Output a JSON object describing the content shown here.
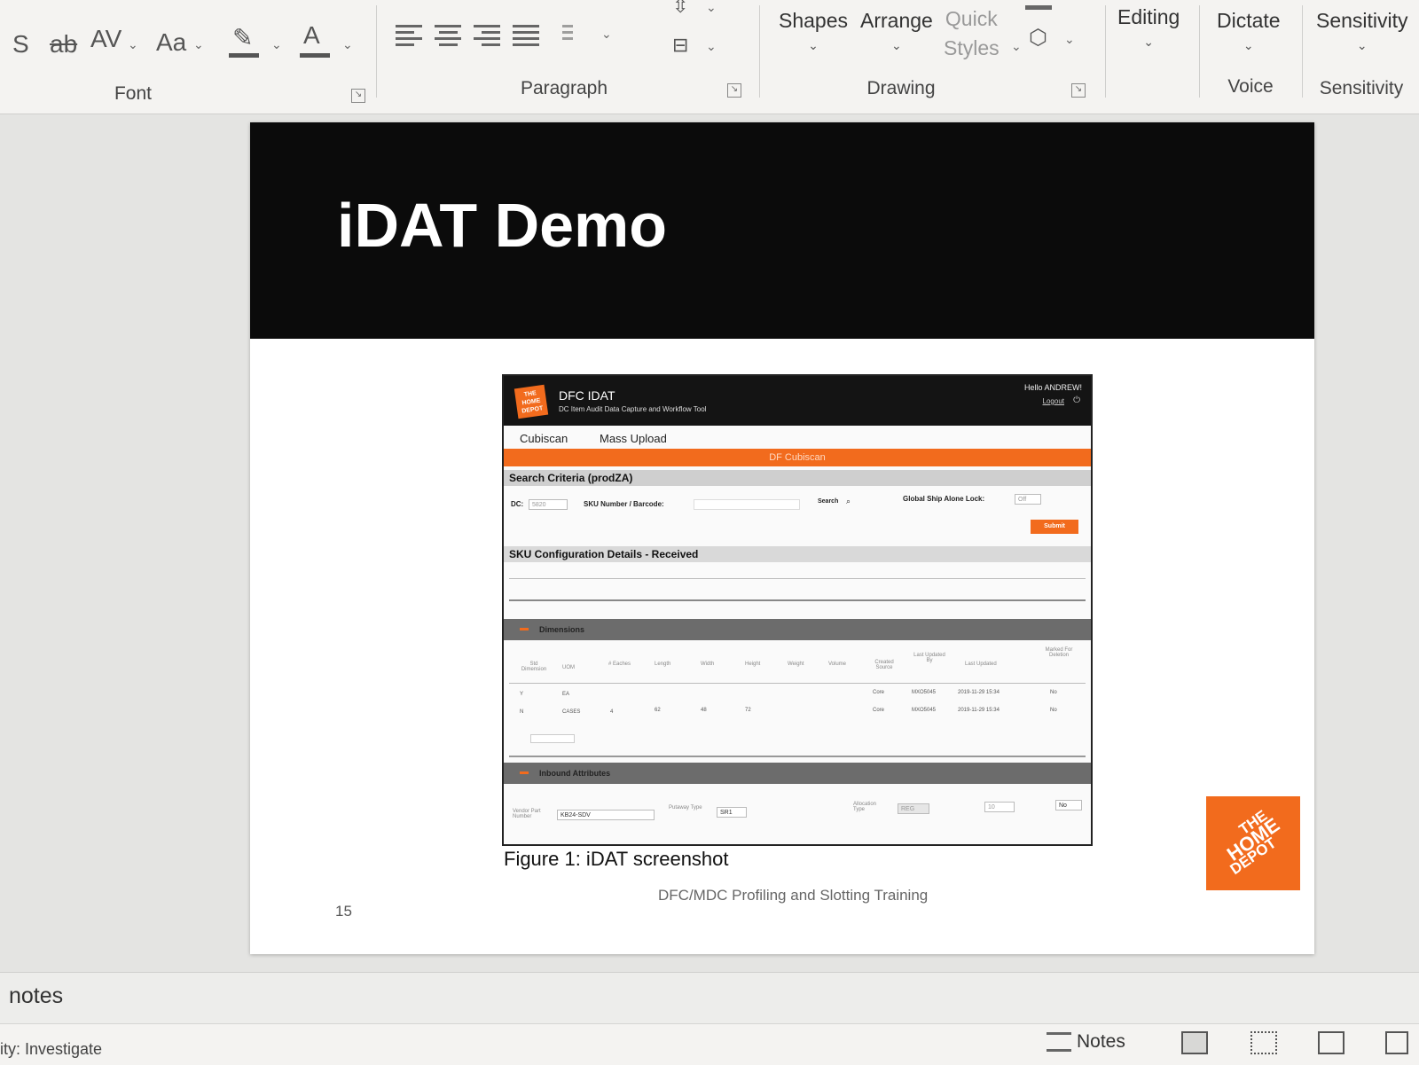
{
  "ribbon": {
    "font": {
      "label": "Font",
      "strikethrough": "ab",
      "char_spacing": "AV",
      "change_case": "Aa",
      "font_color": "A",
      "partial_glyph": "S"
    },
    "paragraph": {
      "label": "Paragraph"
    },
    "drawing": {
      "label": "Drawing",
      "shapes": "Shapes",
      "arrange": "Arrange",
      "quick_styles_line1": "Quick",
      "quick_styles_line2": "Styles"
    },
    "editing": {
      "label": "Editing"
    },
    "voice": {
      "label": "Voice",
      "dictate": "Dictate"
    },
    "sensitivity": {
      "label": "Sensitivity",
      "button": "Sensitivity"
    }
  },
  "slide": {
    "title": "iDAT Demo",
    "caption": "Figure 1: iDAT screenshot",
    "number": "15",
    "footer": "DFC/MDC Profiling and Slotting Training",
    "logo_text_1": "THE",
    "logo_text_2": "HOME",
    "logo_text_3": "DEPOT"
  },
  "embedded_app": {
    "name": "DFC IDAT",
    "tagline": "DC Item Audit Data Capture and Workflow Tool",
    "greeting": "Hello ANDREW!",
    "logout": "Logout",
    "tabs": [
      "Cubiscan",
      "Mass Upload"
    ],
    "banner": "DF Cubiscan",
    "search_title": "Search Criteria (prodZA)",
    "dc_label": "DC:",
    "dc_value": "5820",
    "sku_label": "SKU Number / Barcode:",
    "search_label": "Search",
    "global_lock_label": "Global Ship Alone Lock:",
    "global_lock_value": "Off",
    "submit": "Submit",
    "config_title": "SKU Configuration Details - Received",
    "dimensions_title": "Dimensions",
    "dim_headers": [
      "Std Dimension",
      "UOM",
      "# Eaches",
      "Length",
      "Width",
      "Height",
      "Weight",
      "Volume",
      "Created Source",
      "Last Updated By",
      "Last Updated",
      "Marked For Deletion"
    ],
    "dim_rows": [
      [
        "Y",
        "EA",
        "",
        "",
        "",
        "",
        "",
        "",
        "Core",
        "MXO5045",
        "2019-11-29 15:34",
        "No"
      ],
      [
        "N",
        "CASES",
        "4",
        "62",
        "48",
        "72",
        "",
        "",
        "Core",
        "MXO5045",
        "2019-11-29 15:34",
        "No"
      ]
    ],
    "inbound_title": "Inbound Attributes",
    "vendor_part_label": "Vendor Part Number",
    "vendor_part_value": "KB24-SDV",
    "putaway_label": "Putaway Type",
    "putaway_value": "SR1",
    "allocation_label": "Allocation Type",
    "allocation_value": "REG",
    "dynamic_value": "10",
    "inbound_value": "No"
  },
  "notes": {
    "label": "notes",
    "button": "Notes"
  },
  "status": {
    "text": "ity: Investigate"
  }
}
